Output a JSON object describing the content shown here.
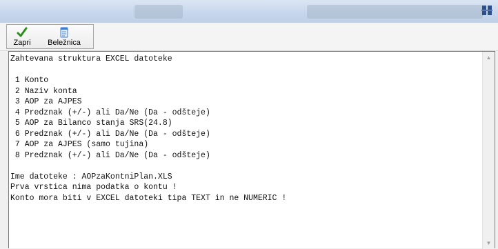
{
  "window": {
    "app_icon": "app-grid-icon"
  },
  "toolbar": {
    "close_label": "Zapri",
    "close_icon": "checkmark-icon",
    "notepad_label": "Beležnica",
    "notepad_icon": "notepad-icon"
  },
  "editor": {
    "text": "Zahtevana struktura EXCEL datoteke\n\n 1 Konto\n 2 Naziv konta\n 3 AOP za AJPES\n 4 Predznak (+/-) ali Da/Ne (Da - odšteje)\n 5 AOP za Bilanco stanja SRS(24.8)\n 6 Predznak (+/-) ali Da/Ne (Da - odšteje)\n 7 AOP za AJPES (samo tujina)\n 8 Predznak (+/-) ali Da/Ne (Da - odšteje)\n\nIme datoteke : AOPzaKontniPlan.XLS\nPrva vrstica nima podatka o kontu !\nKonto mora biti v EXCEL datoteki tipa TEXT in ne NUMERIC !",
    "scroll_up_icon": "scroll-up-arrow-icon",
    "scroll_down_icon": "scroll-down-arrow-icon"
  },
  "colors": {
    "accent_check": "#2e8b1e",
    "notepad_blue": "#3b7fd4"
  }
}
